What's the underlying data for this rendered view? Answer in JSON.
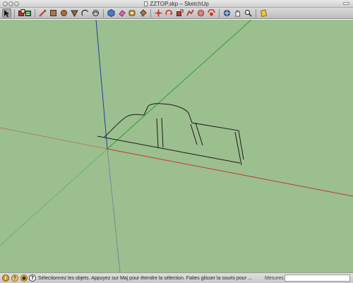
{
  "window": {
    "title": "ZZTOP.skp – SketchUp"
  },
  "toolbar": {
    "tools": [
      {
        "icon": "select-arrow-icon",
        "active": true
      },
      {
        "icon": "make-component-icon"
      },
      {
        "icon": "paint-bucket-icon"
      },
      {
        "icon": "pencil-line-icon"
      },
      {
        "icon": "rectangle-icon"
      },
      {
        "icon": "circle-icon"
      },
      {
        "icon": "polygon-icon"
      },
      {
        "icon": "arc-icon"
      },
      {
        "icon": "freehand-icon"
      },
      {
        "icon": "push-pull-icon"
      },
      {
        "icon": "eraser-icon"
      },
      {
        "icon": "tape-measure-icon"
      },
      {
        "icon": "paint-icon"
      },
      {
        "icon": "move-icon"
      },
      {
        "icon": "rotate-icon"
      },
      {
        "icon": "scale-icon"
      },
      {
        "icon": "follow-me-icon"
      },
      {
        "icon": "offset-icon"
      },
      {
        "icon": "orbit-icon"
      },
      {
        "icon": "pan-icon"
      },
      {
        "icon": "zoom-icon"
      },
      {
        "icon": "zoom-extents-icon"
      },
      {
        "icon": "orbit-camera-icon"
      },
      {
        "icon": "hand-pan-icon"
      },
      {
        "icon": "zoom-magnifier-icon"
      },
      {
        "icon": "warehouse-icon"
      }
    ]
  },
  "status": {
    "message": "Sélectionnez les objets. Appuyez sur Maj pour étendre la sélection. Faites glisser la souris pour ...",
    "measure_label": "Mesures",
    "measure_value": ""
  },
  "colors": {
    "viewport_background": "#9cbf8f",
    "axis_red": "#c0392b",
    "axis_green": "#2e9f2e",
    "axis_blue": "#1f3fa0",
    "sketch_line": "#1a1a1a"
  }
}
